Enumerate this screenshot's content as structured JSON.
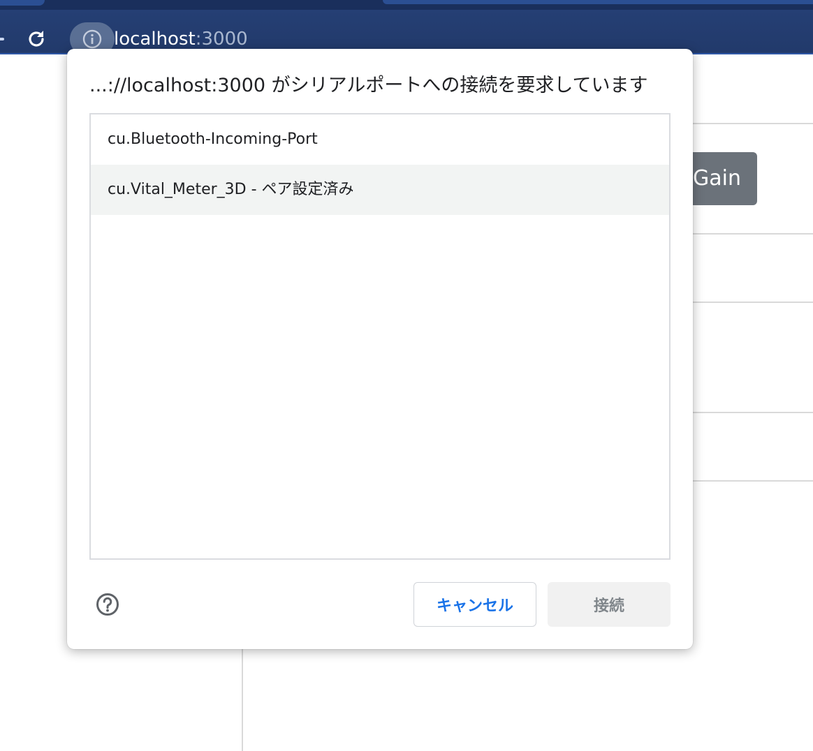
{
  "browser": {
    "address_bar": {
      "host": "localhost",
      "port": ":3000"
    }
  },
  "background_page": {
    "gain_button_label": "Gain"
  },
  "dialog": {
    "title": "...://localhost:3000 がシリアルポートへの接続を要求しています",
    "ports": [
      {
        "label": "cu.Bluetooth-Incoming-Port",
        "selected": false
      },
      {
        "label": "cu.Vital_Meter_3D - ペア設定済み",
        "selected": true
      }
    ],
    "cancel_label": "キャンセル",
    "connect_label": "接続",
    "connect_enabled": false
  },
  "colors": {
    "toolbar": "#223a6b",
    "accent_link": "#1a73e8",
    "selected_row": "#f2f4f3",
    "disabled_text": "#80868b"
  },
  "icons": [
    "reload-icon",
    "info-icon",
    "help-icon"
  ]
}
